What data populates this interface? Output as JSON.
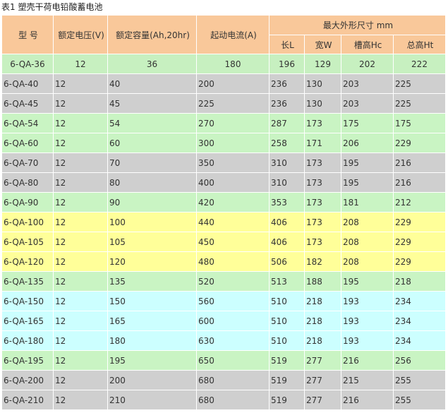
{
  "caption": "表1 塑壳干荷电铅酸蓄电池",
  "headers": {
    "model": "型 号",
    "voltage": "额定电压(V)",
    "capacity": "额定容量(Ah,20hr)",
    "current": "起动电流(A)",
    "dims": "最大外形尺寸 mm",
    "length": "长L",
    "width": "宽W",
    "slot_height": "槽高Hc",
    "total_height": "总高Ht"
  },
  "first_row": [
    "6-QA-36",
    "12",
    "36",
    "180",
    "196",
    "129",
    "202",
    "222"
  ],
  "rows": [
    [
      "6-QA-40",
      "12",
      "40",
      "200",
      "236",
      "130",
      "203",
      "225"
    ],
    [
      "6-QA-45",
      "12",
      "45",
      "225",
      "236",
      "130",
      "203",
      "225"
    ],
    [
      "6-QA-54",
      "12",
      "54",
      "270",
      "287",
      "173",
      "175",
      "175"
    ],
    [
      "6-QA-60",
      "12",
      "60",
      "300",
      "258",
      "171",
      "206",
      "229"
    ],
    [
      "6-QA-70",
      "12",
      "70",
      "350",
      "310",
      "173",
      "195",
      "216"
    ],
    [
      "6-QA-80",
      "12",
      "80",
      "400",
      "310",
      "173",
      "195",
      "216"
    ],
    [
      "6-QA-90",
      "12",
      "90",
      "420",
      "353",
      "173",
      "181",
      "212"
    ],
    [
      "6-QA-100",
      "12",
      "100",
      "440",
      "406",
      "173",
      "208",
      "229"
    ],
    [
      "6-QA-105",
      "12",
      "105",
      "450",
      "406",
      "173",
      "208",
      "229"
    ],
    [
      "6-QA-120",
      "12",
      "120",
      "480",
      "506",
      "182",
      "208",
      "229"
    ],
    [
      "6-QA-135",
      "12",
      "135",
      "520",
      "513",
      "188",
      "195",
      "218"
    ],
    [
      "6-QA-150",
      "12",
      "150",
      "560",
      "510",
      "218",
      "193",
      "234"
    ],
    [
      "6-QA-165",
      "12",
      "165",
      "600",
      "510",
      "218",
      "193",
      "234"
    ],
    [
      "6-QA-180",
      "12",
      "180",
      "630",
      "510",
      "218",
      "193",
      "234"
    ],
    [
      "6-QA-195",
      "12",
      "195",
      "650",
      "519",
      "277",
      "216",
      "256"
    ],
    [
      "6-QA-200",
      "12",
      "200",
      "680",
      "519",
      "277",
      "215",
      "255"
    ],
    [
      "6-QA-210",
      "12",
      "210",
      "680",
      "519",
      "277",
      "216",
      "255"
    ]
  ],
  "row_colors": [
    "grey",
    "grey",
    "green",
    "green",
    "grey",
    "grey",
    "green",
    "yellow",
    "yellow",
    "yellow",
    "green",
    "cyan",
    "cyan",
    "cyan",
    "green",
    "grey",
    "grey"
  ],
  "colors": {
    "header": "#f9c89a",
    "first_row": "#c7f0c0",
    "grey": "#cfcfcf",
    "green": "#c9f4c3",
    "yellow": "#ffff99",
    "cyan": "#ccffff"
  }
}
